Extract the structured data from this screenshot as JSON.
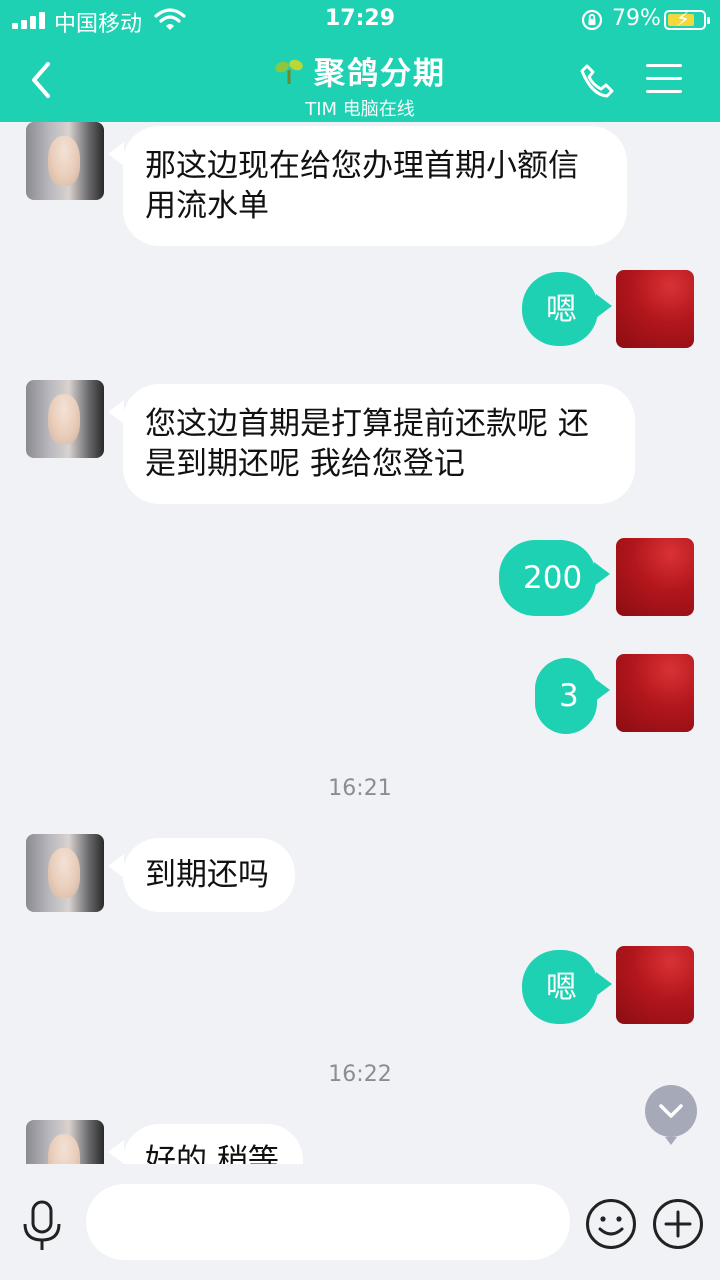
{
  "status": {
    "carrier": "中国移动",
    "time": "17:29",
    "battery": "79%"
  },
  "header": {
    "title": "聚鸽分期",
    "subtitle": "TIM 电脑在线"
  },
  "messages": [
    {
      "side": "left",
      "text": "那这边现在给您办理首期小额信用流水单"
    },
    {
      "side": "right",
      "text": "嗯"
    },
    {
      "side": "left",
      "text": "您这边首期是打算提前还款呢 还是到期还呢  我给您登记"
    },
    {
      "side": "right",
      "text": "200"
    },
    {
      "side": "right",
      "text": "3"
    },
    {
      "side": "time",
      "text": "16:21"
    },
    {
      "side": "left",
      "text": "到期还吗"
    },
    {
      "side": "right",
      "text": "嗯"
    },
    {
      "side": "time",
      "text": "16:22"
    },
    {
      "side": "left",
      "text": "好的 稍等"
    }
  ],
  "input": {
    "placeholder": ""
  },
  "colors": {
    "accent": "#1ed1b2",
    "background": "#f1f2f6",
    "bubble_left": "#ffffff"
  },
  "icons": [
    "signal-icon",
    "wifi-icon",
    "rotation-lock-icon",
    "battery-icon",
    "back-icon",
    "sprout-icon",
    "phone-icon",
    "menu-icon",
    "chevron-down-icon",
    "microphone-icon",
    "emoji-icon",
    "plus-icon"
  ]
}
